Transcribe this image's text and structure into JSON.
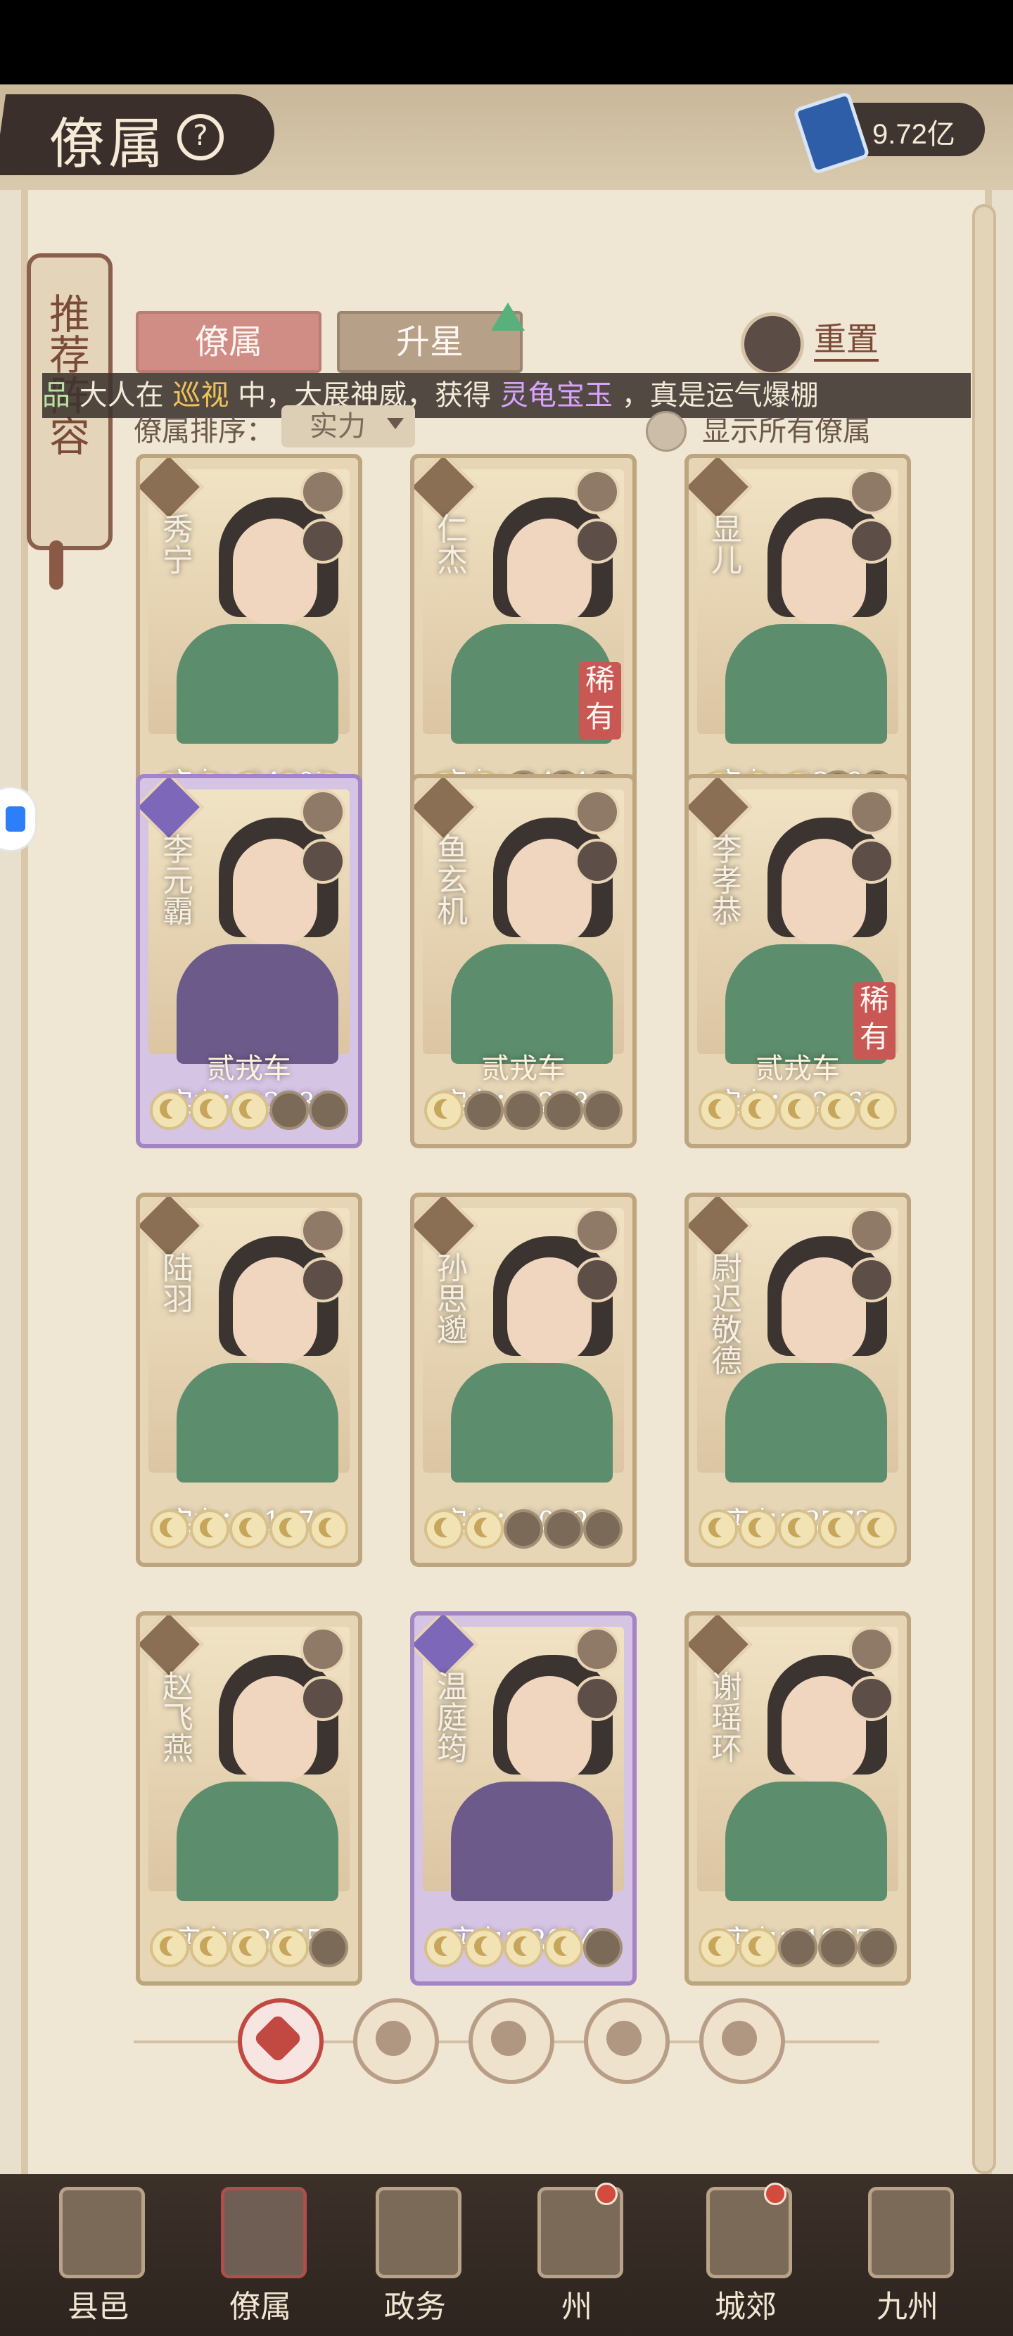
{
  "header": {
    "title": "僚属",
    "help_symbol": "?",
    "currency_value": "9.72亿"
  },
  "side_tab": {
    "label": "推荐阵容"
  },
  "tabs": {
    "active": "僚属",
    "inactive": "升星",
    "reset_label": "重置"
  },
  "ticker": {
    "part1": "品",
    "part2": "大人在",
    "part3": "巡视",
    "part4": "中，大展神威，获得",
    "part5": "灵龟宝玉",
    "part6": "，真是运气爆棚"
  },
  "sort": {
    "label": "僚属排序：",
    "selected": "实力",
    "show_all": "显示所有僚属"
  },
  "cards": [
    {
      "name": "秀宁",
      "power": "实力：24505",
      "rarity": "",
      "subtitle": "",
      "stars": 5,
      "purple": false
    },
    {
      "name": "仁杰",
      "power": "实力：24043",
      "rarity": "稀有",
      "subtitle": "",
      "stars": 2,
      "purple": false
    },
    {
      "name": "显儿",
      "power": "实力：23494",
      "rarity": "",
      "subtitle": "",
      "stars": 3,
      "purple": false
    },
    {
      "name": "李元霸",
      "power": "实力：22588",
      "rarity": "",
      "subtitle": "贰戎车",
      "stars": 3,
      "purple": true
    },
    {
      "name": "鱼玄机",
      "power": "实力：22489",
      "rarity": "",
      "subtitle": "贰戎车",
      "stars": 1,
      "purple": false
    },
    {
      "name": "李孝恭",
      "power": "实力：22162",
      "rarity": "稀有",
      "subtitle": "贰戎车",
      "stars": 5,
      "purple": false
    },
    {
      "name": "陆羽",
      "power": "实力：21876",
      "rarity": "",
      "subtitle": "",
      "stars": 5,
      "purple": false
    },
    {
      "name": "孙思邈",
      "power": "实力：20328",
      "rarity": "",
      "subtitle": "",
      "stars": 2,
      "purple": false
    },
    {
      "name": "尉迟敬德",
      "power": "实力：2772",
      "rarity": "",
      "subtitle": "",
      "stars": 5,
      "purple": false
    },
    {
      "name": "赵飞燕",
      "power": "实力：2255",
      "rarity": "",
      "subtitle": "",
      "stars": 4,
      "purple": false
    },
    {
      "name": "温庭筠",
      "power": "实力：2014",
      "rarity": "",
      "subtitle": "",
      "stars": 4,
      "purple": true
    },
    {
      "name": "谢瑶环",
      "power": "实力：1997",
      "rarity": "",
      "subtitle": "",
      "stars": 2,
      "purple": false
    }
  ],
  "bottom_nav": [
    {
      "label": "县邑",
      "active": false,
      "dot": false
    },
    {
      "label": "僚属",
      "active": true,
      "dot": false
    },
    {
      "label": "政务",
      "active": false,
      "dot": false
    },
    {
      "label": "州",
      "active": false,
      "dot": true
    },
    {
      "label": "城郊",
      "active": false,
      "dot": true
    },
    {
      "label": "九州",
      "active": false,
      "dot": false
    }
  ]
}
